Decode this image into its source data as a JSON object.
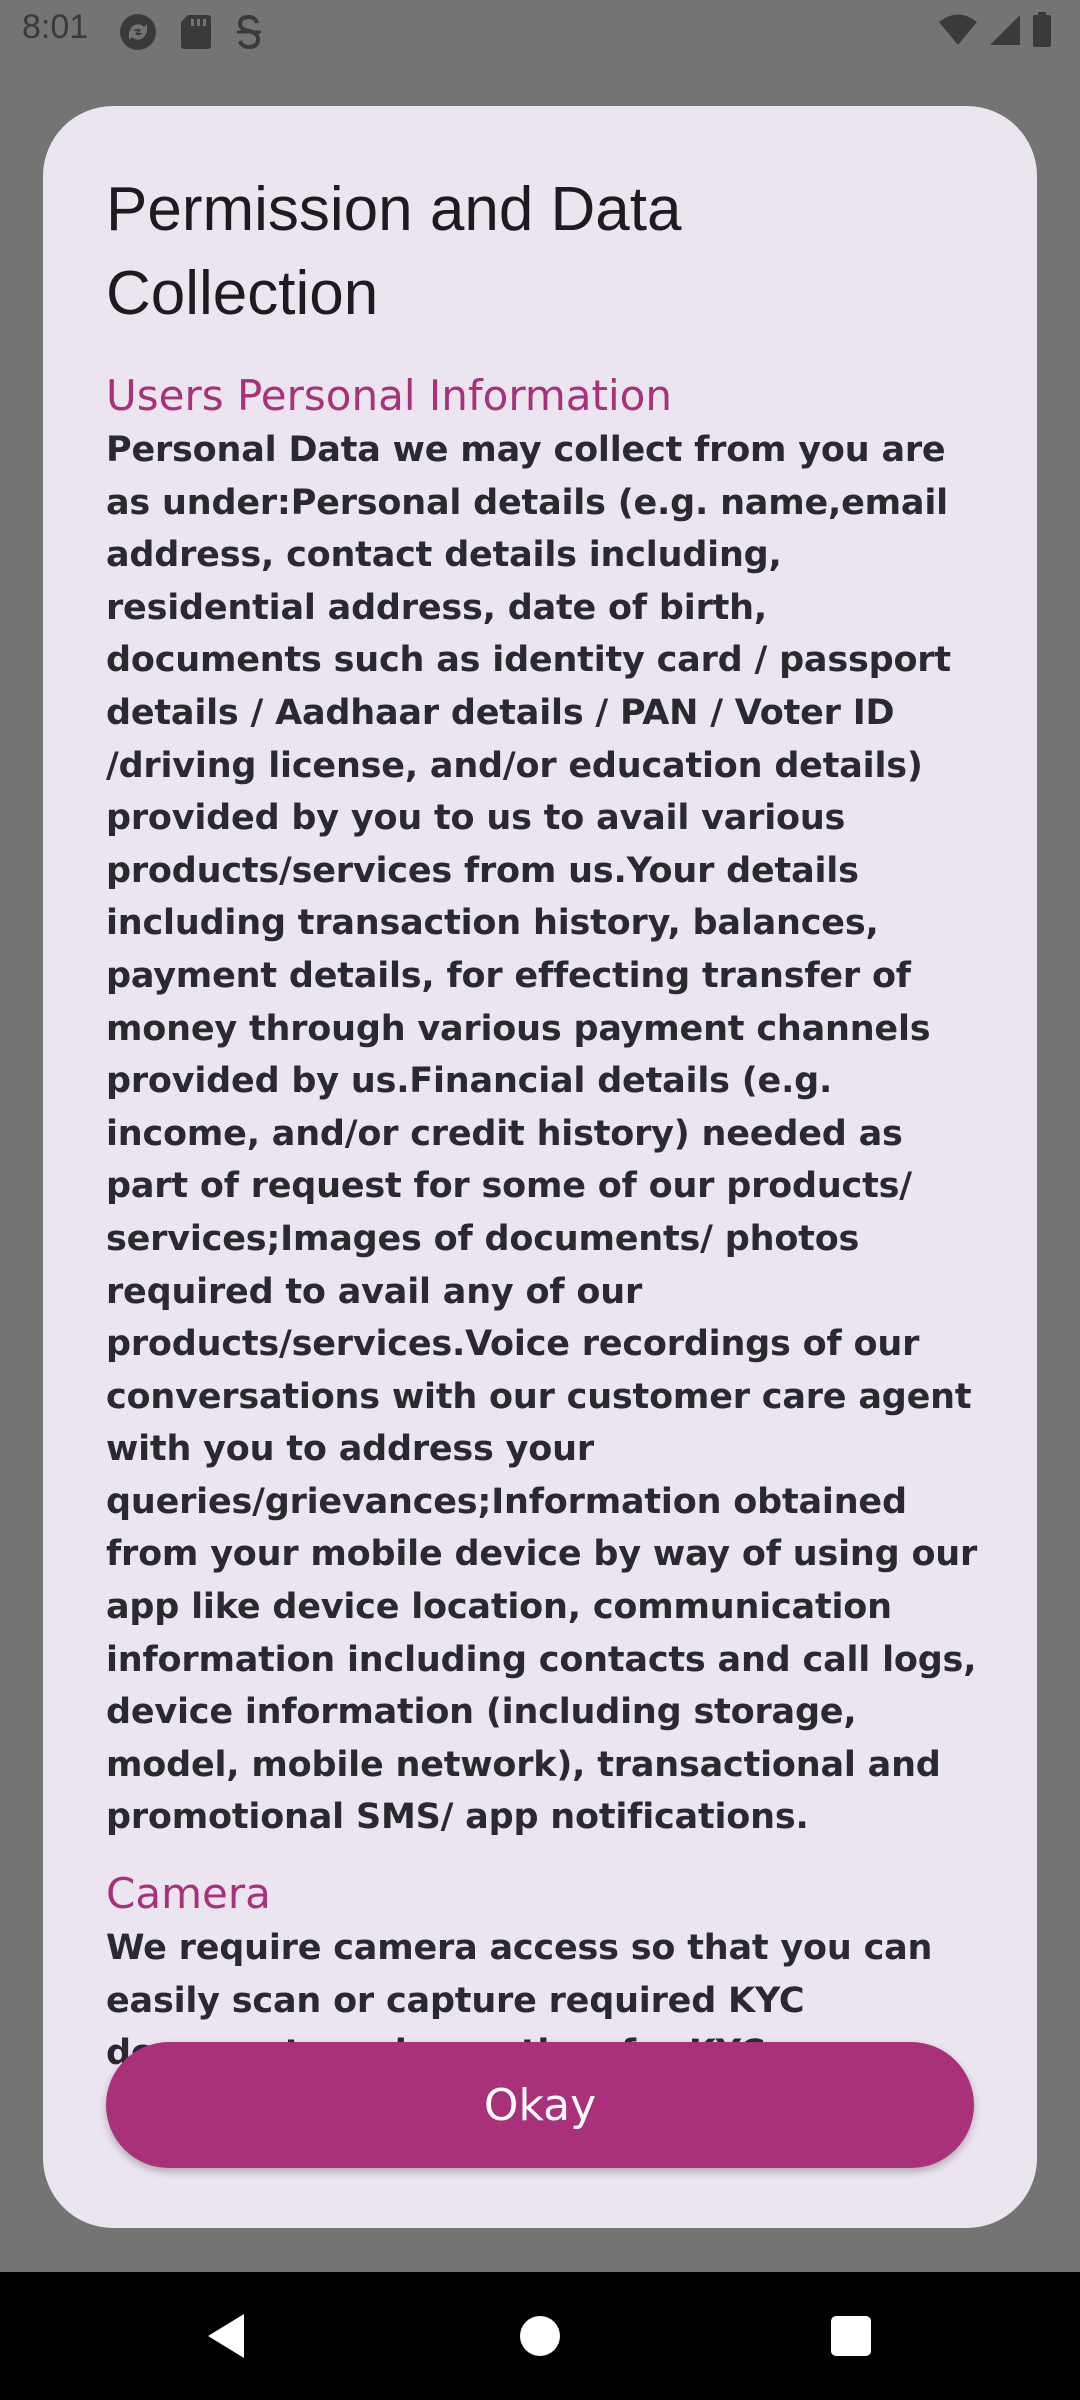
{
  "status_bar": {
    "time": "8:01",
    "left_icons": [
      "sync-icon",
      "sd-card-icon",
      "s-app-icon"
    ],
    "right_icons": [
      "wifi-icon",
      "cellular-signal-icon",
      "battery-icon"
    ]
  },
  "dialog": {
    "title": "Permission and Data Collection",
    "sections": [
      {
        "heading": "Users Personal Information",
        "body": "Personal Data we may collect from you are as under:Personal details (e.g. name,email address, contact details including, residential address, date of birth, documents such as identity card / passport details / Aadhaar details / PAN / Voter ID /driving license, and/or education details) provided by you to us to avail various products/services from us.Your details including transaction history, balances, payment details, for effecting transfer of money through various payment channels provided by us.Financial details (e.g. income, and/or credit history) needed as part of request for some of our products/ services;Images of documents/ photos required to avail any of our products/services.Voice recordings of our conversations with our customer care agent with you to address your queries/grievances;Information obtained from your mobile device by way of using our app like device location, communication information including contacts and call logs, device information (including storage, model, mobile network), transactional and promotional SMS/ app notifications."
      },
      {
        "heading": "Camera",
        "body": "We require camera access so that you can easily scan or capture required KYC documents and save time for KYC purpose. This ensures"
      }
    ],
    "okay_label": "Okay"
  },
  "nav_bar": {
    "icons": [
      "back-icon",
      "home-icon",
      "recents-icon"
    ]
  },
  "colors": {
    "accent": "#a8317a",
    "dialog_bg": "#ebe5ef",
    "scrim": "#747474"
  }
}
